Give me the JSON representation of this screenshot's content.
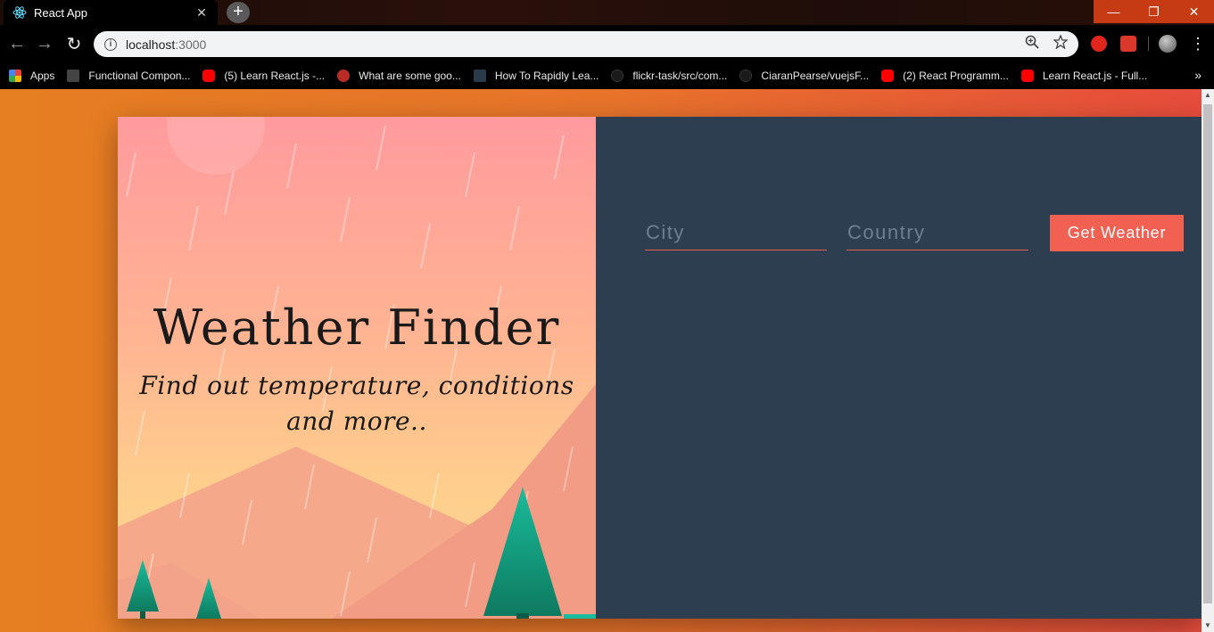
{
  "browser": {
    "tab": {
      "title": "React App",
      "icon": "react-icon",
      "close": "✕"
    },
    "new_tab": "+",
    "window_controls": {
      "minimize": "—",
      "maximize": "❐",
      "close": "✕"
    },
    "nav": {
      "back": "←",
      "forward": "→",
      "reload": "↻"
    },
    "address": {
      "host": "localhost",
      "port": ":3000"
    },
    "bookmarks": [
      {
        "label": "Apps",
        "icon": "apps-grid-icon",
        "color": "#4285f4"
      },
      {
        "label": "Functional Compon...",
        "icon": "page-icon",
        "color": "#444444"
      },
      {
        "label": "(5) Learn React.js -...",
        "icon": "youtube-icon",
        "color": "#ff0000"
      },
      {
        "label": "What are some goo...",
        "icon": "quora-icon",
        "color": "#b92b27"
      },
      {
        "label": "How To Rapidly Lea...",
        "icon": "react-icon",
        "color": "#2b3a4a"
      },
      {
        "label": "flickr-task/src/com...",
        "icon": "github-icon",
        "color": "#1a1a1a"
      },
      {
        "label": "CiaranPearse/vuejsF...",
        "icon": "github-icon",
        "color": "#1a1a1a"
      },
      {
        "label": "(2) React Programm...",
        "icon": "youtube-icon",
        "color": "#ff0000"
      },
      {
        "label": "Learn React.js - Full...",
        "icon": "youtube-icon",
        "color": "#ff0000"
      }
    ],
    "bookmarks_more": "»"
  },
  "app": {
    "title": "Weather Finder",
    "subtitle": "Find out temperature, conditions and more..",
    "form": {
      "city_placeholder": "City",
      "country_placeholder": "Country",
      "submit_label": "Get Weather"
    },
    "colors": {
      "background_start": "#e67e22",
      "background_end": "#e74c3c",
      "form_panel": "#2c3e50",
      "accent": "#f16051"
    }
  }
}
